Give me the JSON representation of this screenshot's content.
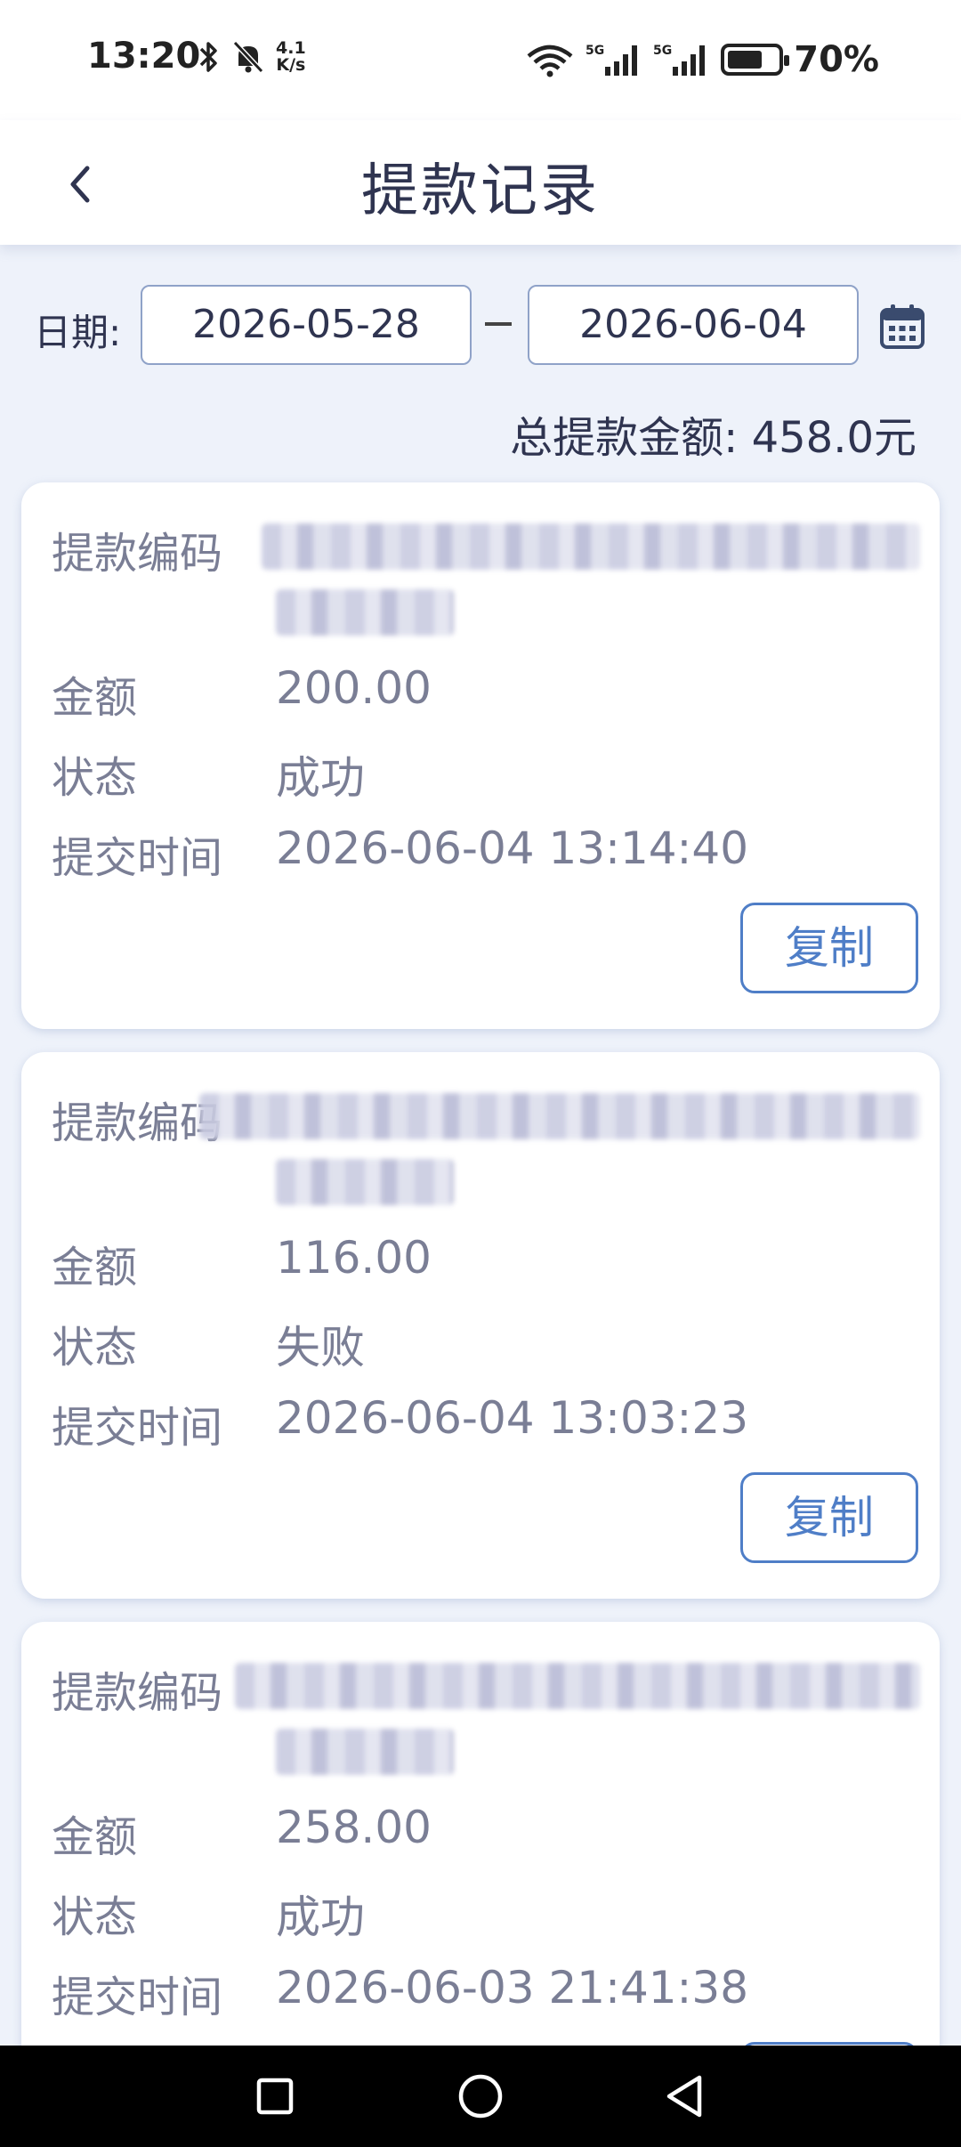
{
  "status_bar": {
    "time": "13:20",
    "net_speed_value": "4.1",
    "net_speed_unit": "K/s",
    "battery_text": "70%",
    "battery_level": 0.7,
    "icons": [
      "bluetooth-icon",
      "mute-icon",
      "wifi-icon",
      "5g-signal-icon",
      "5g-signal-icon",
      "battery-icon"
    ]
  },
  "header": {
    "title": "提款记录",
    "back_icon": "chevron-left-icon"
  },
  "filter": {
    "date_label": "日期:",
    "start_date": "2026-05-28",
    "end_date": "2026-06-04",
    "calendar_icon": "calendar-icon"
  },
  "summary": {
    "total_text": "总提款金额: 458.0元"
  },
  "labels": {
    "id": "提款编码",
    "amount": "金额",
    "status": "状态",
    "time": "提交时间",
    "copy": "复制"
  },
  "records": [
    {
      "amount": "200.00",
      "status": "成功",
      "time": "2026-06-04 13:14:40"
    },
    {
      "amount": "116.00",
      "status": "失败",
      "time": "2026-06-04 13:03:23"
    },
    {
      "amount": "258.00",
      "status": "成功",
      "time": "2026-06-03 21:41:38"
    }
  ],
  "colors": {
    "accent": "#4f7ec7",
    "background": "#eef2fa",
    "text_primary": "#2f3450",
    "text_secondary": "#7a7e95"
  }
}
